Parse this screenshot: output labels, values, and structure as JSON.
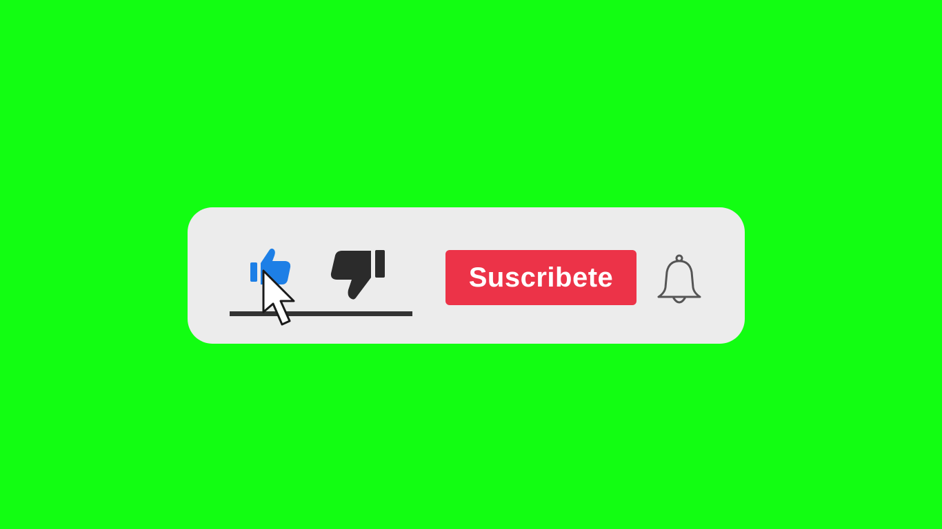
{
  "colors": {
    "background": "#12fe12",
    "panel": "#ececec",
    "like_active": "#1d7fe6",
    "dislike": "#2b2b2b",
    "subscribe": "#ec3348",
    "subscribe_text": "#ffffff",
    "divider": "#333333"
  },
  "actions": {
    "like": {
      "icon": "thumbs-up-icon",
      "state": "active"
    },
    "dislike": {
      "icon": "thumbs-down-icon"
    },
    "subscribe": {
      "label": "Suscribete"
    },
    "notifications": {
      "icon": "bell-icon"
    }
  },
  "pointer": {
    "icon": "mouse-cursor-icon"
  }
}
